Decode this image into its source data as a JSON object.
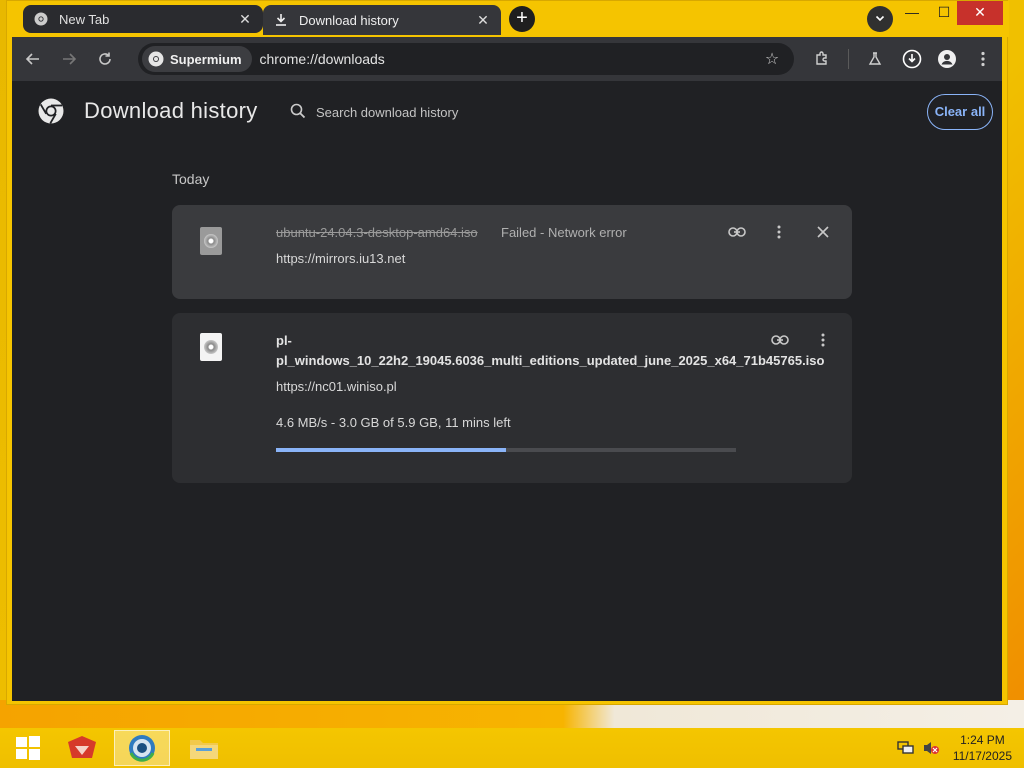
{
  "browser": {
    "tabs": [
      {
        "label": "New Tab",
        "close": "✕"
      },
      {
        "label": "Download history",
        "close": "✕"
      }
    ],
    "new_tab_symbol": "+",
    "window_controls": {
      "minimize": "—",
      "maximize": "☐",
      "close": "✕"
    },
    "toolbar": {
      "chip_label": "Supermium",
      "url": "chrome://downloads"
    }
  },
  "page": {
    "title": "Download history",
    "search_placeholder": "Search download history",
    "clear_all": "Clear all",
    "section_label": "Today",
    "downloads": [
      {
        "filename": "ubuntu-24.04.3-desktop-amd64.iso",
        "status": "Failed - Network error",
        "source": "https://mirrors.iu13.net",
        "state": "failed"
      },
      {
        "filename": "pl-pl_windows_10_22h2_19045.6036_multi_editions_updated_june_2025_x64_71b45765.iso",
        "source": "https://nc01.winiso.pl",
        "progress_text": "4.6 MB/s - 3.0 GB of 5.9 GB, 11 mins left",
        "progress_fraction": 0.5,
        "state": "in-progress"
      }
    ]
  },
  "taskbar": {
    "time": "1:24 PM",
    "date": "11/17/2025"
  },
  "colors": {
    "accent": "#8ab4f8",
    "page_bg": "#202124",
    "frame": "#f5c400"
  }
}
